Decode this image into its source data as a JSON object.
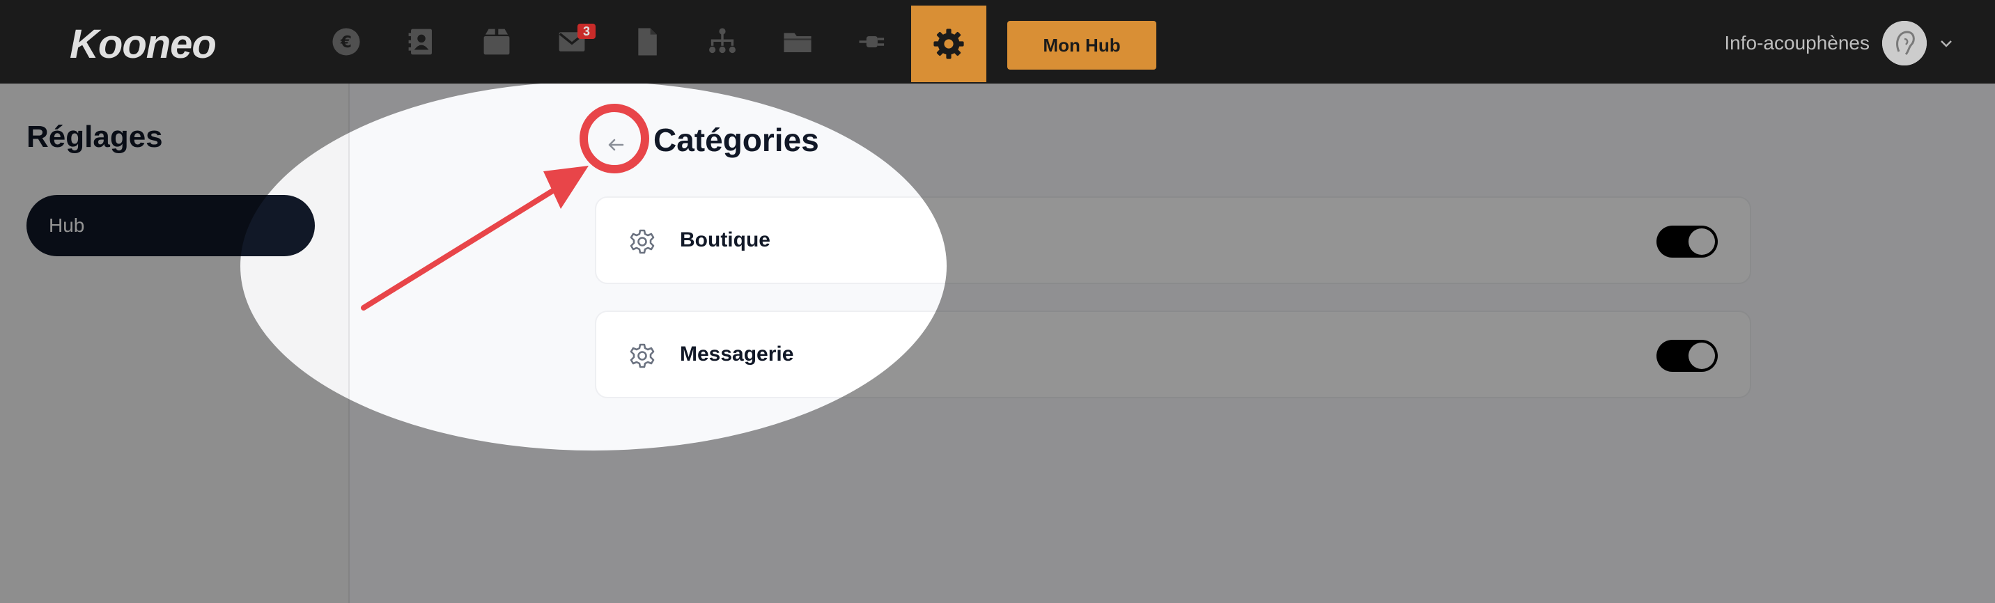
{
  "brand": {
    "logo": "Kooneo",
    "accent": "#f7a33d"
  },
  "topbar": {
    "nav_icons": [
      "euro-icon",
      "contacts-icon",
      "box-icon",
      "mail-icon",
      "file-icon",
      "sitemap-icon",
      "folder-icon",
      "plug-icon",
      "gear-icon"
    ],
    "mail_badge": "3",
    "hub_button": "Mon Hub",
    "account_name": "Info-acouphènes"
  },
  "sidebar": {
    "title": "Réglages",
    "items": [
      {
        "label": "Hub",
        "active": true
      }
    ]
  },
  "main": {
    "title": "Catégories",
    "categories": [
      {
        "label": "Boutique",
        "enabled": true
      },
      {
        "label": "Messagerie",
        "enabled": true
      }
    ]
  }
}
